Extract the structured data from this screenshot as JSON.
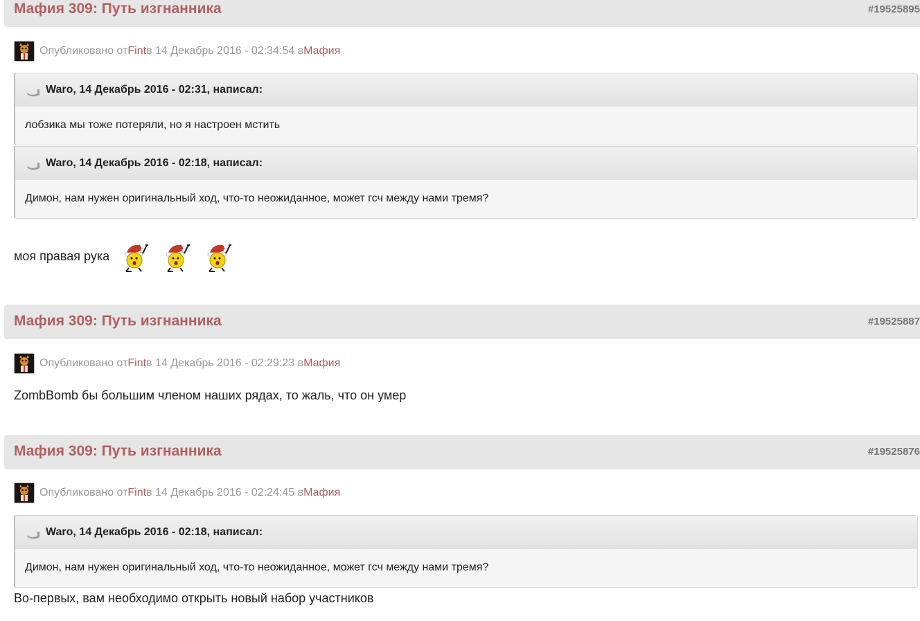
{
  "posts": [
    {
      "title": "Мафия 309: Путь изгнанника",
      "id": "#19525895",
      "meta": {
        "published_prefix": "Опубликовано от ",
        "author": "Fint",
        "date": " в 14 Декабрь 2016 - 02:34:54 в ",
        "forum": "Мафия"
      },
      "quotes": [
        {
          "header": "Waro, 14 Декабрь 2016 - 02:31, написал:",
          "text": "лобзика мы тоже потеряли, но я настроен мстить"
        },
        {
          "header": "Waro, 14 Декабрь 2016 - 02:18, написал:",
          "text": "Димон, нам нужен оригинальный ход, что-то неожиданное, может гсч между нами тремя?"
        }
      ],
      "text": "моя правая рука",
      "smilies": [
        "santa-smiley-icon",
        "santa-smiley-icon",
        "santa-smiley-icon"
      ]
    },
    {
      "title": "Мафия 309: Путь изгнанника",
      "id": "#19525887",
      "meta": {
        "published_prefix": "Опубликовано от ",
        "author": "Fint",
        "date": " в 14 Декабрь 2016 - 02:29:23 в ",
        "forum": "Мафия"
      },
      "text": "ZombBomb бы большим членом наших рядах, то жаль, что он умер"
    },
    {
      "title": "Мафия 309: Путь изгнанника",
      "id": "#19525876",
      "meta": {
        "published_prefix": "Опубликовано от ",
        "author": "Fint",
        "date": " в 14 Декабрь 2016 - 02:24:45 в ",
        "forum": "Мафия"
      },
      "quotes": [
        {
          "header": "Waro, 14 Декабрь 2016 - 02:18, написал:",
          "text": "Димон, нам нужен оригинальный ход, что-то неожиданное, может гсч между нами тремя?"
        }
      ],
      "text": "Во-первых, вам необходимо открыть новый набор участников"
    }
  ],
  "colors": {
    "title": "#b06060",
    "link": "#b06060",
    "muted": "#9a9a9a",
    "header_bg": "#e6e6e6",
    "post_id": "#777777"
  }
}
